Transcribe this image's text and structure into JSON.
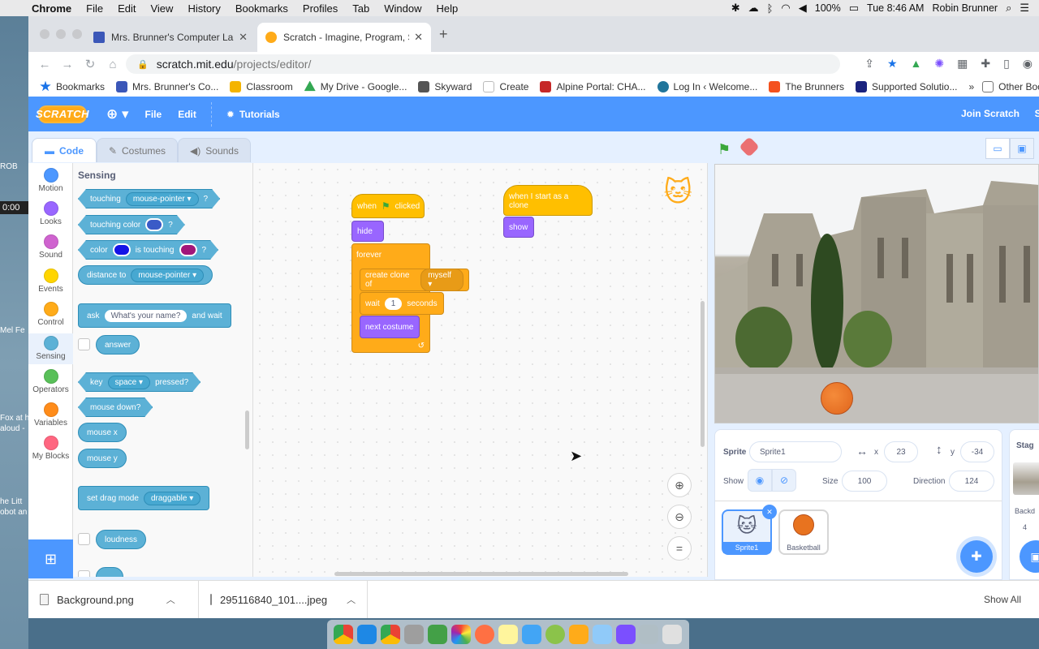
{
  "menubar": {
    "app": "Chrome",
    "items": [
      "File",
      "Edit",
      "View",
      "History",
      "Bookmarks",
      "Profiles",
      "Tab",
      "Window",
      "Help"
    ],
    "battery": "100%",
    "datetime": "Tue 8:46 AM",
    "user": "Robin Brunner"
  },
  "desktop": {
    "labels": [
      "ROB",
      "0:00",
      "Mel Fe",
      "Fox at h",
      "aloud -",
      "he Litt",
      "obot an"
    ]
  },
  "browser": {
    "tabs": [
      {
        "title": "Mrs. Brunner's Computer Lab",
        "color": "#3b57b8"
      },
      {
        "title": "Scratch - Imagine, Program, Sh",
        "color": "#ffab19"
      }
    ],
    "url_host": "scratch.mit.edu",
    "url_path": "/projects/editor/",
    "bookmarks": [
      {
        "label": "Bookmarks",
        "color": "#1a73e8"
      },
      {
        "label": "Mrs. Brunner's Co...",
        "color": "#3b57b8"
      },
      {
        "label": "Classroom",
        "color": "#f4b400"
      },
      {
        "label": "My Drive - Google...",
        "color": "#34a853"
      },
      {
        "label": "Skyward",
        "color": "#555555"
      },
      {
        "label": "Create",
        "color": "#999999"
      },
      {
        "label": "Alpine Portal: CHA...",
        "color": "#c62828"
      },
      {
        "label": "Log In ‹ Welcome...",
        "color": "#21759b"
      },
      {
        "label": "The Brunners",
        "color": "#f4511e"
      },
      {
        "label": "Supported Solutio...",
        "color": "#1a237e"
      }
    ],
    "bookmarks_more": "»",
    "other_bookmarks": "Other Bookm"
  },
  "scratch": {
    "logo": "SCRATCH",
    "menu": {
      "file": "File",
      "edit": "Edit",
      "tutorials": "Tutorials",
      "join": "Join Scratch",
      "sign": "Si"
    },
    "tabs": {
      "code": "Code",
      "costumes": "Costumes",
      "sounds": "Sounds"
    },
    "categories": [
      {
        "label": "Motion",
        "color": "#4c97ff"
      },
      {
        "label": "Looks",
        "color": "#9966ff"
      },
      {
        "label": "Sound",
        "color": "#cf63cf"
      },
      {
        "label": "Events",
        "color": "#ffd500"
      },
      {
        "label": "Control",
        "color": "#ffab19"
      },
      {
        "label": "Sensing",
        "color": "#5cb1d6"
      },
      {
        "label": "Operators",
        "color": "#59c059"
      },
      {
        "label": "Variables",
        "color": "#ff8c1a"
      },
      {
        "label": "My Blocks",
        "color": "#ff6680"
      }
    ],
    "palette": {
      "title": "Sensing",
      "touching": "touching",
      "mouse_pointer": "mouse-pointer",
      "q": "?",
      "touching_color": "touching color",
      "color": "color",
      "is_touching": "is touching",
      "distance_to": "distance to",
      "ask": "ask",
      "ask_default": "What's your name?",
      "and_wait": "and wait",
      "answer": "answer",
      "key": "key",
      "space": "space",
      "pressed": "pressed?",
      "mouse_down": "mouse down?",
      "mouse_x": "mouse x",
      "mouse_y": "mouse y",
      "set_drag_mode": "set drag mode",
      "draggable": "draggable",
      "loudness": "loudness"
    },
    "script1": {
      "when": "when",
      "clicked": "clicked",
      "hide": "hide",
      "forever": "forever",
      "create_clone_of": "create clone of",
      "myself": "myself",
      "wait": "wait",
      "wait_value": "1",
      "seconds": "seconds",
      "next_costume": "next costume"
    },
    "script2": {
      "hat": "when I start as a clone",
      "show": "show"
    },
    "sprite_info": {
      "sprite_label": "Sprite",
      "sprite_name": "Sprite1",
      "x_label": "x",
      "x": "23",
      "y_label": "y",
      "y": "-34",
      "show_label": "Show",
      "size_label": "Size",
      "size": "100",
      "direction_label": "Direction",
      "direction": "124"
    },
    "sprites": [
      {
        "name": "Sprite1",
        "selected": true
      },
      {
        "name": "Basketball",
        "selected": false
      }
    ],
    "stage_pane": {
      "title": "Stag",
      "backdrops_label": "Backd",
      "backdrops_count": "4"
    }
  },
  "downloads": {
    "files": [
      "Background.png",
      "295116840_101....jpeg"
    ],
    "show_all": "Show All"
  }
}
